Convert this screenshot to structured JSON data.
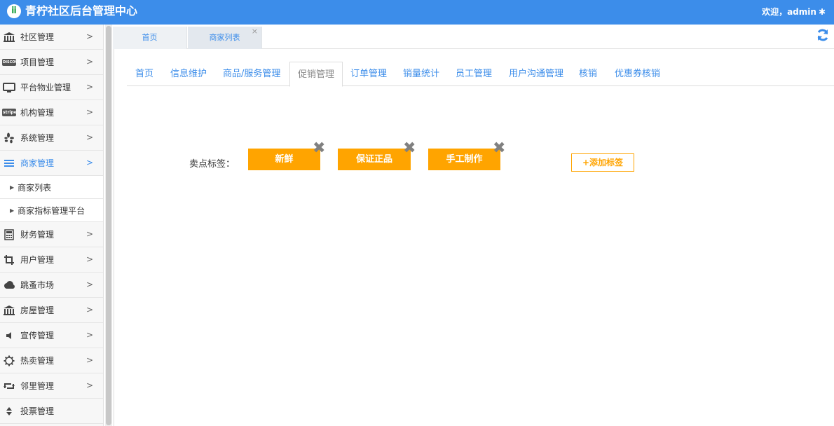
{
  "header": {
    "logo_glyph": "ⅱ",
    "title": "青柠社区后台管理中心",
    "welcome": "欢迎，admin"
  },
  "sidebar": {
    "items": [
      {
        "label": "社区管理",
        "icon": "bank-icon"
      },
      {
        "label": "项目管理",
        "icon": "discover-card-icon",
        "icon_text": "DISCOVER"
      },
      {
        "label": "平台物业管理",
        "icon": "monitor-icon"
      },
      {
        "label": "机构管理",
        "icon": "stripe-icon",
        "icon_text": "stripe"
      },
      {
        "label": "系统管理",
        "icon": "yelp-icon"
      },
      {
        "label": "商家管理",
        "icon": "list-icon",
        "active": true
      },
      {
        "label": "财务管理",
        "icon": "calculator-icon"
      },
      {
        "label": "用户管理",
        "icon": "crop-icon"
      },
      {
        "label": "跳蚤市场",
        "icon": "cloud-icon"
      },
      {
        "label": "房屋管理",
        "icon": "bank-icon"
      },
      {
        "label": "宣传管理",
        "icon": "volume-icon"
      },
      {
        "label": "热卖管理",
        "icon": "gear-icon"
      },
      {
        "label": "邻里管理",
        "icon": "retweet-icon"
      },
      {
        "label": "投票管理",
        "icon": "sort-icon"
      }
    ],
    "sub_items": [
      {
        "label": "商家列表"
      },
      {
        "label": "商家指标管理平台"
      }
    ]
  },
  "tabs": [
    {
      "label": "首页"
    },
    {
      "label": "商家列表"
    }
  ],
  "subnav": [
    {
      "label": "首页"
    },
    {
      "label": "信息维护"
    },
    {
      "label": "商品/服务管理"
    },
    {
      "label": "促销管理",
      "active": true
    },
    {
      "label": "订单管理"
    },
    {
      "label": "销量统计"
    },
    {
      "label": "员工管理"
    },
    {
      "label": "用户沟通管理"
    },
    {
      "label": "核销"
    },
    {
      "label": "优惠券核销"
    }
  ],
  "tags_section": {
    "label": "卖点标签：",
    "tags": [
      "新鲜",
      "保证正品",
      "手工制作"
    ],
    "add_label": "+添加标签"
  },
  "colors": {
    "header_bg": "#3c8dea",
    "accent": "#3c8dea",
    "tag_bg": "#ffa400"
  }
}
